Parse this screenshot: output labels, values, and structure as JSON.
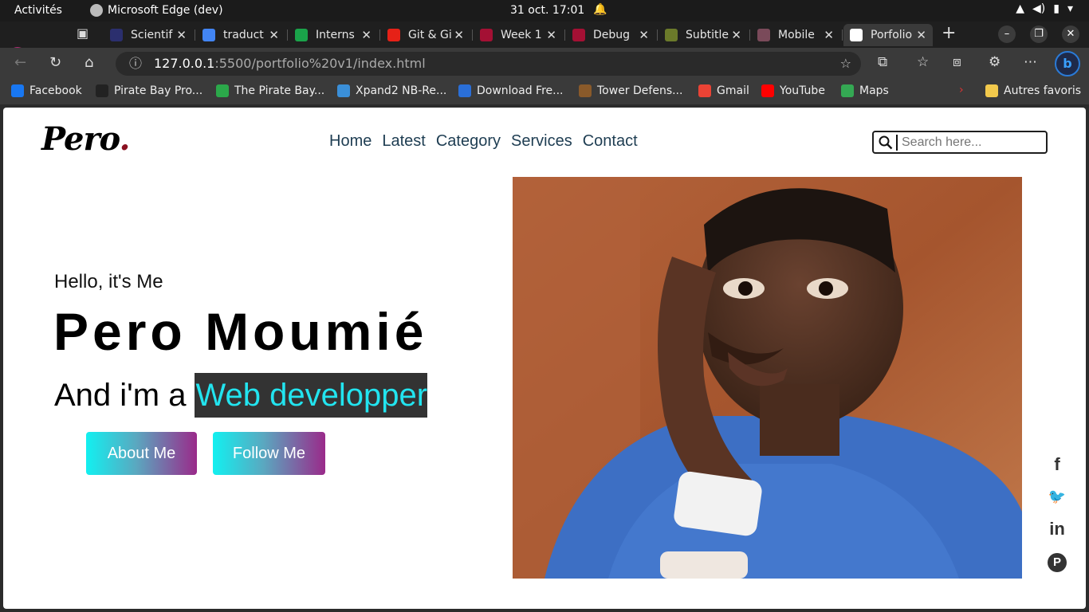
{
  "system_bar": {
    "activities": "Activités",
    "app_name": "Microsoft Edge (dev)",
    "clock": "31 oct.  17:01"
  },
  "tabs": [
    {
      "label": "Scientif",
      "color": "#2b2f6e"
    },
    {
      "label": "traduct",
      "color": "#4285f4"
    },
    {
      "label": "Interns",
      "color": "#1aa34a"
    },
    {
      "label": "Git & Gi",
      "color": "#e62117"
    },
    {
      "label": "Week 1",
      "color": "#a41034"
    },
    {
      "label": "Debug",
      "color": "#a41034"
    },
    {
      "label": "Subtitle",
      "color": "#6b7a2a"
    },
    {
      "label": "Mobile",
      "color": "#7a4a5a"
    },
    {
      "label": "Porfolio",
      "color": "#ffffff"
    }
  ],
  "address": {
    "host": "127.0.0.1",
    "rest": ":5500/portfolio%20v1/index.html"
  },
  "bookmarks": [
    {
      "label": "Facebook",
      "color": "#1877f2"
    },
    {
      "label": "Pirate Bay Pro...",
      "color": "#222222"
    },
    {
      "label": "The Pirate Bay...",
      "color": "#2ba84a"
    },
    {
      "label": "Xpand2 NB-Re...",
      "color": "#3a8fd8"
    },
    {
      "label": "Download Fre...",
      "color": "#2a6fd8"
    },
    {
      "label": "Tower Defens...",
      "color": "#8a5a2a"
    },
    {
      "label": "Gmail",
      "color": "#ea4335"
    },
    {
      "label": "YouTube",
      "color": "#ff0000"
    },
    {
      "label": "Maps",
      "color": "#34a853"
    }
  ],
  "other_favorites": "Autres favoris",
  "site": {
    "logo": "Pero",
    "logo_dot": ".",
    "nav": [
      "Home",
      "Latest",
      "Category",
      "Services",
      "Contact"
    ],
    "search_placeholder": "Search here...",
    "greeting": "Hello, it's Me",
    "name": "Pero Moumié",
    "role_prefix": "And i'm a",
    "role_highlight": "Web developper",
    "buttons": {
      "about": "About Me",
      "follow": "Follow Me"
    },
    "social": [
      {
        "icon": "facebook-icon",
        "glyph": "f"
      },
      {
        "icon": "twitter-icon",
        "glyph": "🐦"
      },
      {
        "icon": "linkedin-icon",
        "glyph": "in"
      },
      {
        "icon": "pinterest-icon",
        "glyph": "P"
      }
    ]
  }
}
